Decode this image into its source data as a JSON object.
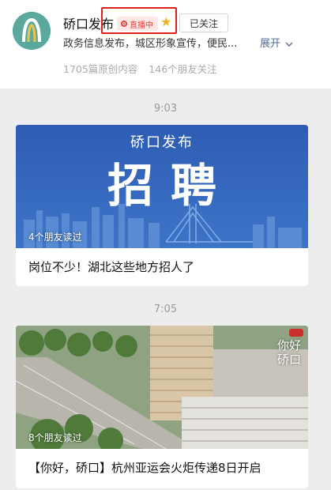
{
  "account": {
    "name": "硚口发布",
    "live_badge": "直播中",
    "follow_label": "已关注",
    "description": "政务信息发布，城区形象宣传，便民...",
    "expand_label": "展开",
    "articles_count": "1705篇原创内容",
    "friends_following": "146个朋友关注"
  },
  "feed": [
    {
      "time": "9:03",
      "cover_brand": "硚口发布",
      "cover_headline": "招聘",
      "read_label": "4个朋友读过",
      "title": "岗位不少！湖北这些地方招人了"
    },
    {
      "time": "7:05",
      "cover_watermark": "你好硚口",
      "read_label": "8个朋友读过",
      "title": "【你好，硚口】杭州亚运会火炬传递8日开启"
    }
  ],
  "colors": {
    "live_red": "#e64340",
    "star": "#f3b21e",
    "link_blue": "#576b95",
    "recruit_blue": "#2f5fb5"
  }
}
